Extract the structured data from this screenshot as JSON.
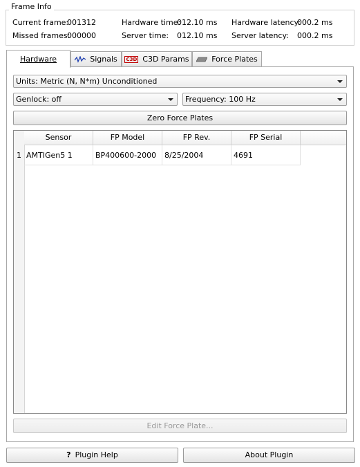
{
  "frame_info": {
    "title": "Frame Info",
    "current_frame_label": "Current frame:",
    "current_frame_value": "001312",
    "missed_frames_label": "Missed frames:",
    "missed_frames_value": "000000",
    "hardware_time_label": "Hardware time:",
    "hardware_time_value": "012.10 ms",
    "server_time_label": "Server time:",
    "server_time_value": "012.10 ms",
    "hardware_latency_label": "Hardware latency:",
    "hardware_latency_value": "000.2 ms",
    "server_latency_label": "Server latency:",
    "server_latency_value": "000.2 ms"
  },
  "tabs": [
    {
      "label": "Hardware",
      "icon": "none",
      "active": true
    },
    {
      "label": "Signals",
      "icon": "signal-icon",
      "active": false
    },
    {
      "label": "C3D Params",
      "icon": "c3d-icon",
      "icon_text": "C3D",
      "active": false
    },
    {
      "label": "Force Plates",
      "icon": "plate-icon",
      "active": false
    }
  ],
  "hardware": {
    "units_value": "Units: Metric (N, N*m) Unconditioned",
    "genlock_value": "Genlock:  off",
    "frequency_value": "Frequency: 100 Hz",
    "zero_button": "Zero Force Plates",
    "table": {
      "columns": [
        "Sensor",
        "FP Model",
        "FP Rev.",
        "FP Serial"
      ],
      "rows": [
        {
          "num": "1",
          "cells": [
            "AMTIGen5 1",
            "BP400600-2000",
            "8/25/2004",
            "4691"
          ]
        }
      ]
    },
    "edit_button": "Edit Force Plate..."
  },
  "footer": {
    "help_icon": "?",
    "help_button": "Plugin Help",
    "about_button": "About Plugin"
  },
  "colors": {
    "border": "#a8a8a8",
    "disabled_text": "#9a9a9a",
    "c3d_red": "#c00000"
  }
}
